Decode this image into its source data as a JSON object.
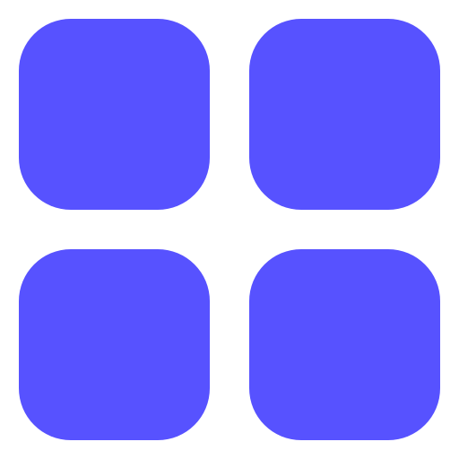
{
  "icon": {
    "name": "grid-icon",
    "color": "#5752FF",
    "background": "#ffffff",
    "tiles": [
      "top-left",
      "top-right",
      "bottom-left",
      "bottom-right"
    ]
  }
}
